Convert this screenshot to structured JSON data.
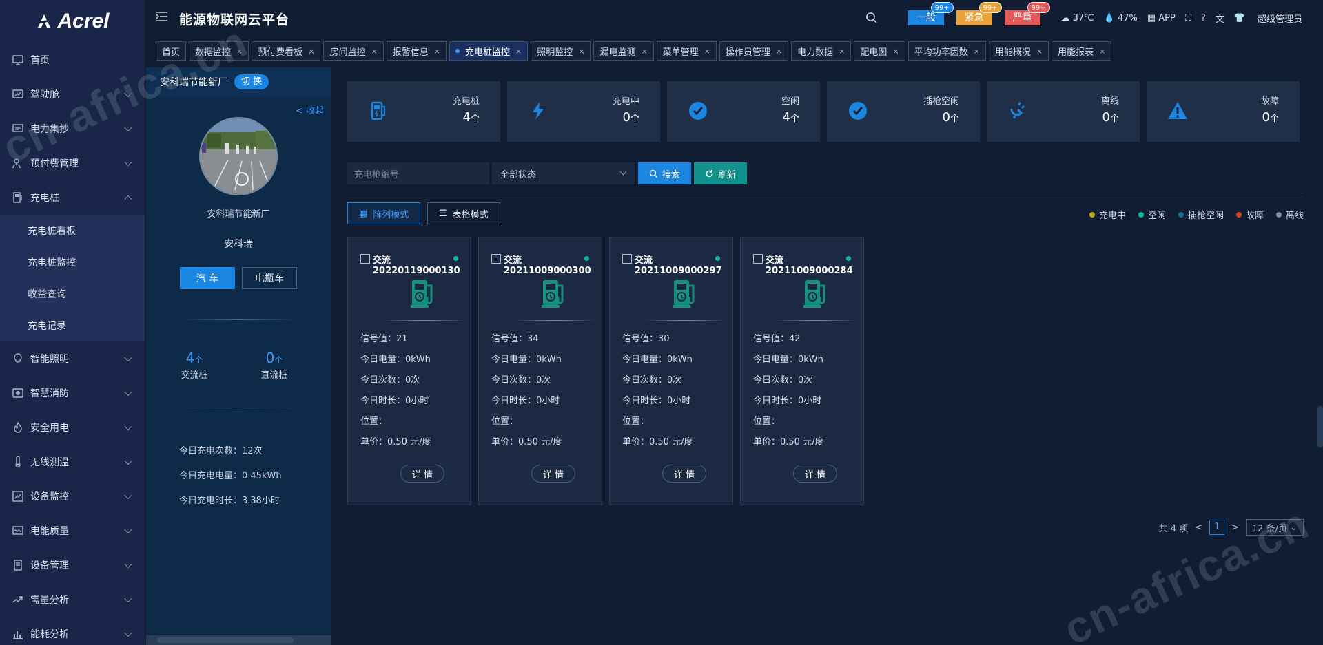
{
  "brand": "Acrel",
  "app_title": "能源物联网云平台",
  "sidebar": {
    "items": [
      {
        "label": "首页",
        "icon": "monitor-icon",
        "chevron": false
      },
      {
        "label": "驾驶舱",
        "icon": "dashboard-icon",
        "chevron": true
      },
      {
        "label": "电力集抄",
        "icon": "meter-icon",
        "chevron": true
      },
      {
        "label": "预付费管理",
        "icon": "user-card-icon",
        "chevron": true
      },
      {
        "label": "充电桩",
        "icon": "charger-icon",
        "chevron": true,
        "expanded": true
      }
    ],
    "sub_items": [
      "充电桩看板",
      "充电桩监控",
      "收益查询",
      "充电记录"
    ],
    "items_after": [
      {
        "label": "智能照明",
        "icon": "bulb-icon"
      },
      {
        "label": "智慧消防",
        "icon": "fire-alarm-icon"
      },
      {
        "label": "安全用电",
        "icon": "flame-icon"
      },
      {
        "label": "无线测温",
        "icon": "thermometer-icon"
      },
      {
        "label": "设备监控",
        "icon": "device-monitor-icon"
      },
      {
        "label": "电能质量",
        "icon": "power-quality-icon"
      },
      {
        "label": "设备管理",
        "icon": "device-manage-icon"
      },
      {
        "label": "需量分析",
        "icon": "trend-icon"
      },
      {
        "label": "能耗分析",
        "icon": "bar-chart-icon"
      }
    ]
  },
  "header": {
    "alerts": [
      {
        "label": "一般",
        "count": "99+",
        "color": "#1b86e0"
      },
      {
        "label": "紧急",
        "count": "99+",
        "color": "#e8a23a"
      },
      {
        "label": "严重",
        "count": "99+",
        "color": "#e15959"
      }
    ],
    "temperature": "37℃",
    "humidity": "47%",
    "app_label": "APP",
    "user": "超级管理员"
  },
  "tabs": [
    {
      "label": "首页",
      "closable": false
    },
    {
      "label": "数据监控",
      "closable": true
    },
    {
      "label": "预付费看板",
      "closable": true
    },
    {
      "label": "房间监控",
      "closable": true
    },
    {
      "label": "报警信息",
      "closable": true
    },
    {
      "label": "充电桩监控",
      "closable": true,
      "active": true
    },
    {
      "label": "照明监控",
      "closable": true
    },
    {
      "label": "漏电监测",
      "closable": true
    },
    {
      "label": "菜单管理",
      "closable": true
    },
    {
      "label": "操作员管理",
      "closable": true
    },
    {
      "label": "电力数据",
      "closable": true
    },
    {
      "label": "配电图",
      "closable": true
    },
    {
      "label": "平均功率因数",
      "closable": true
    },
    {
      "label": "用能概况",
      "closable": true
    },
    {
      "label": "用能报表",
      "closable": true
    }
  ],
  "left_panel": {
    "station": "安科瑞节能新厂",
    "switch_label": "切 换",
    "collapse_label": "收起",
    "station_name": "安科瑞节能新厂",
    "owner": "安科瑞",
    "car_btn": "汽 车",
    "ebike_btn": "电瓶车",
    "ac_count": "4",
    "ac_unit": "个",
    "ac_label": "交流桩",
    "dc_count": "0",
    "dc_unit": "个",
    "dc_label": "直流桩",
    "today_count": "今日充电次数：12次",
    "today_energy": "今日充电电量：0.45kWh",
    "today_duration": "今日充电时长：3.38小时"
  },
  "summary": [
    {
      "title": "充电桩",
      "value": "4",
      "unit": "个",
      "icon": "charging-pile-icon"
    },
    {
      "title": "充电中",
      "value": "0",
      "unit": "个",
      "icon": "lightning-icon"
    },
    {
      "title": "空闲",
      "value": "4",
      "unit": "个",
      "icon": "check-circle-icon"
    },
    {
      "title": "插枪空闲",
      "value": "0",
      "unit": "个",
      "icon": "check-circle-icon"
    },
    {
      "title": "离线",
      "value": "0",
      "unit": "个",
      "icon": "plug-icon"
    },
    {
      "title": "故障",
      "value": "0",
      "unit": "个",
      "icon": "warning-icon"
    }
  ],
  "filters": {
    "search_placeholder": "充电枪编号",
    "status_value": "全部状态",
    "search_btn": "搜索",
    "refresh_btn": "刷新"
  },
  "modes": {
    "array": "阵列模式",
    "table": "表格模式"
  },
  "legend": [
    {
      "label": "充电中",
      "color": "#b9a91e"
    },
    {
      "label": "空闲",
      "color": "#14b79a"
    },
    {
      "label": "插枪空闲",
      "color": "#1b6f8f"
    },
    {
      "label": "故障",
      "color": "#d9461b"
    },
    {
      "label": "离线",
      "color": "#8a8f98"
    }
  ],
  "piles": [
    {
      "name": "交流20220119000130",
      "signal": "信号值：21",
      "energy": "今日电量：0kWh",
      "times": "今日次数：0次",
      "duration": "今日时长：0小时",
      "location": "位置：",
      "price": "单价：0.50 元/度",
      "detail": "详 情"
    },
    {
      "name": "交流20211009000300",
      "signal": "信号值：34",
      "energy": "今日电量：0kWh",
      "times": "今日次数：0次",
      "duration": "今日时长：0小时",
      "location": "位置：",
      "price": "单价：0.50 元/度",
      "detail": "详 情"
    },
    {
      "name": "交流20211009000297",
      "signal": "信号值：30",
      "energy": "今日电量：0kWh",
      "times": "今日次数：0次",
      "duration": "今日时长：0小时",
      "location": "位置：",
      "price": "单价：0.50 元/度",
      "detail": "详 情"
    },
    {
      "name": "交流20211009000284",
      "signal": "信号值：42",
      "energy": "今日电量：0kWh",
      "times": "今日次数：0次",
      "duration": "今日时长：0小时",
      "location": "位置：",
      "price": "单价：0.50 元/度",
      "detail": "详 情"
    }
  ],
  "pager": {
    "total": "共 4 项",
    "page": "1",
    "size": "12 条/页"
  },
  "watermark": "cn-africa.cn"
}
